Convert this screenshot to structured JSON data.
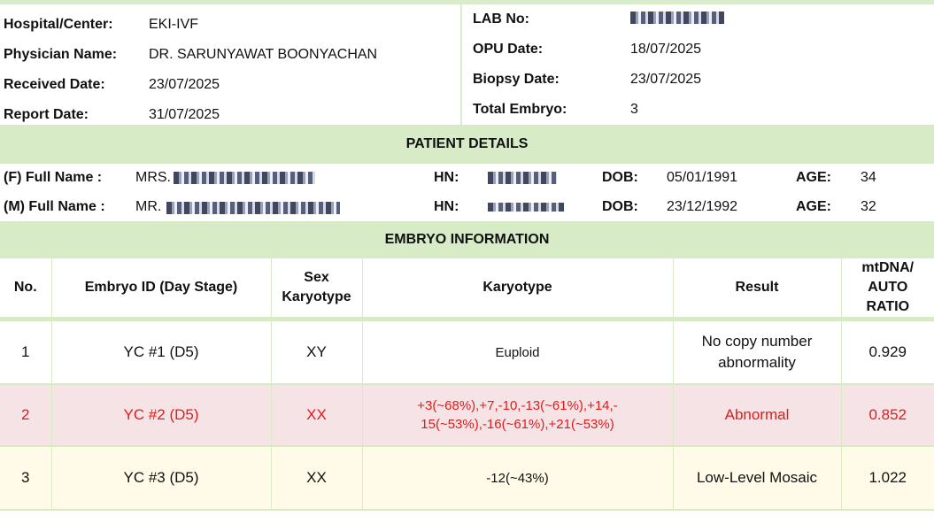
{
  "header": {
    "hospital_label": "Hospital/Center:",
    "hospital_value": "EKI-IVF",
    "physician_label": "Physician Name:",
    "physician_value": "DR. SARUNYAWAT BOONYACHAN",
    "received_label": "Received Date:",
    "received_value": "23/07/2025",
    "report_label": "Report Date:",
    "report_value": "31/07/2025",
    "lab_label": "LAB No:",
    "opu_label": "OPU Date:",
    "opu_value": "18/07/2025",
    "biopsy_label": "Biopsy Date:",
    "biopsy_value": "23/07/2025",
    "total_label": "Total Embryo:",
    "total_value": "3"
  },
  "patient": {
    "section_title": "PATIENT  DETAILS",
    "female": {
      "label": "(F) Full Name :",
      "prefix": "MRS.",
      "hn_label": "HN:",
      "dob_label": "DOB:",
      "dob_value": "05/01/1991",
      "age_label": "AGE:",
      "age_value": "34"
    },
    "male": {
      "label": "(M) Full Name :",
      "prefix": "MR.",
      "hn_label": "HN:",
      "dob_label": "DOB:",
      "dob_value": "23/12/1992",
      "age_label": "AGE:",
      "age_value": "32"
    }
  },
  "embryo": {
    "section_title": "EMBRYO INFORMATION",
    "columns": {
      "no": "No.",
      "id": "Embryo ID (Day Stage)",
      "sex_line1": "Sex",
      "sex_line2": "Karyotype",
      "karyotype": "Karyotype",
      "result": "Result",
      "ratio_line1": "mtDNA/",
      "ratio_line2": "AUTO",
      "ratio_line3": "RATIO"
    },
    "rows": [
      {
        "no": "1",
        "id": "YC #1 (D5)",
        "sex": "XY",
        "karyotype_l1": "Euploid",
        "karyotype_l2": "",
        "result_l1": "No copy number",
        "result_l2": "abnormality",
        "ratio": "0.929"
      },
      {
        "no": "2",
        "id": "YC #2 (D5)",
        "sex": "XX",
        "karyotype_l1": "+3(~68%),+7,-10,-13(~61%),+14,-",
        "karyotype_l2": "15(~53%),-16(~61%),+21(~53%)",
        "result_l1": "Abnormal",
        "result_l2": "",
        "ratio": "0.852"
      },
      {
        "no": "3",
        "id": "YC #3 (D5)",
        "sex": "XX",
        "karyotype_l1": "-12(~43%)",
        "karyotype_l2": "",
        "result_l1": "Low-Level Mosaic",
        "result_l2": "",
        "ratio": "1.022"
      }
    ]
  }
}
